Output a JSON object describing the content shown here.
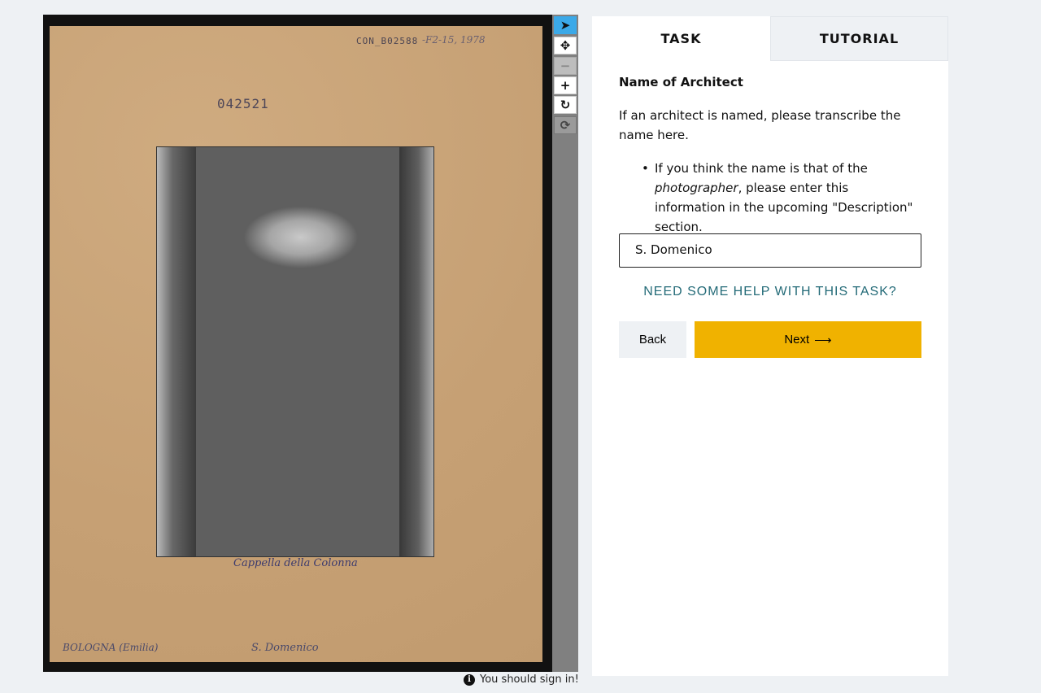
{
  "viewer": {
    "stamp_code": "CON_B02588",
    "stamp_hand": "-F2-15,  1978",
    "inventory_number": "042521",
    "caption_middle": "Cappella della Colonna",
    "caption_location": "BOLOGNA (Emilia)",
    "caption_church": "S. Domenico",
    "photo_description": "black-and-white photo of a baroque church ceiling"
  },
  "toolbar": {
    "tools": [
      {
        "name": "pointer-tool",
        "icon": "cursor-icon",
        "glyph": "➤"
      },
      {
        "name": "move-tool",
        "icon": "move-icon",
        "glyph": "✥"
      },
      {
        "name": "zoom-out-tool",
        "icon": "minus-icon",
        "glyph": "−"
      },
      {
        "name": "zoom-in-tool",
        "icon": "plus-icon",
        "glyph": "+"
      },
      {
        "name": "rotate-tool",
        "icon": "rotate-icon",
        "glyph": "↻"
      },
      {
        "name": "reset-tool",
        "icon": "refresh-icon",
        "glyph": "⟳"
      }
    ]
  },
  "signin": {
    "text": "You should sign in!",
    "icon": "info-icon"
  },
  "panel": {
    "tabs": [
      {
        "label": "TASK"
      },
      {
        "label": "TUTORIAL"
      }
    ],
    "task_title": "Name of Architect",
    "instruction": "If an architect is named, please transcribe the name here.",
    "bullet_prefix": "If you think the name is that of the",
    "bullet_italic": "photographer",
    "bullet_suffix": ", please enter this information in the upcoming \"Description\" section.",
    "answer_value": "S. Domenico",
    "help_link": "NEED SOME HELP WITH THIS TASK?",
    "back_label": "Back",
    "next_label": "Next",
    "next_icon": "arrow-right-icon"
  },
  "colors": {
    "next_button": "#f0b200",
    "help_link": "#246b78",
    "active_tool": "#3ba9e8",
    "page_background": "#eef1f4"
  }
}
